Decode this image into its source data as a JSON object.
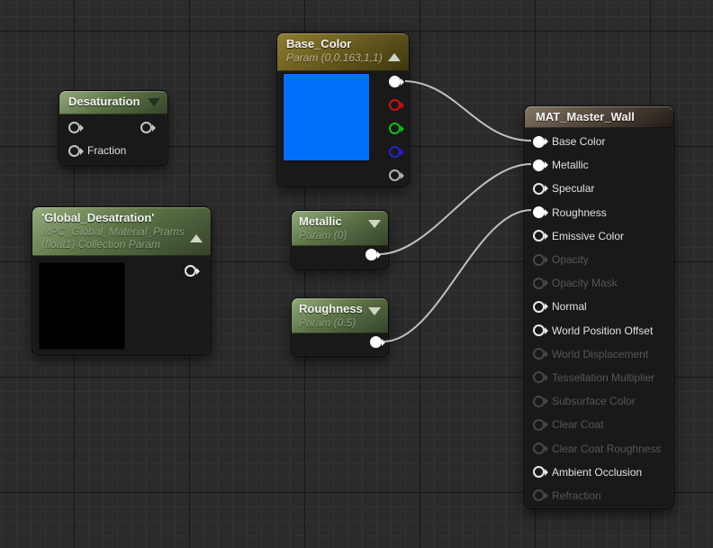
{
  "graph": {
    "background_color": "#2b2b2b",
    "wire_color": "#cdcdcd"
  },
  "nodes": {
    "desaturation": {
      "title": "Desaturation",
      "collapse_arrow": "down",
      "fraction_label": "Fraction"
    },
    "base_color": {
      "title": "Base_Color",
      "subtitle": "Param (0,0.163,1,1)",
      "collapse_arrow": "up",
      "swatch_color": "#0070fa",
      "output_pins": [
        {
          "name": "rgb",
          "color": "#ffffff",
          "filled": true
        },
        {
          "name": "red-channel",
          "color": "#cf1010",
          "filled": false
        },
        {
          "name": "green-channel",
          "color": "#16bd16",
          "filled": false
        },
        {
          "name": "blue-channel",
          "color": "#2222cf",
          "filled": false
        },
        {
          "name": "alpha-channel",
          "color": "#b2b2b2",
          "filled": false
        }
      ]
    },
    "global_desatration": {
      "title": "'Global_Desatration'",
      "subtitle": "MPC_Global_Material_Prams (float1) Collection Param",
      "collapse_arrow": "up",
      "swatch_color": "#000000"
    },
    "metallic": {
      "title": "Metallic",
      "subtitle": "Param (0)",
      "collapse_arrow": "down"
    },
    "roughness": {
      "title": "Roughness",
      "subtitle": "Param (0.5)",
      "collapse_arrow": "down"
    },
    "mat_master_wall": {
      "title": "MAT_Master_Wall",
      "inputs": [
        {
          "label": "Base Color",
          "state": "connected"
        },
        {
          "label": "Metallic",
          "state": "connected"
        },
        {
          "label": "Specular",
          "state": "open"
        },
        {
          "label": "Roughness",
          "state": "connected"
        },
        {
          "label": "Emissive Color",
          "state": "open"
        },
        {
          "label": "Opacity",
          "state": "disabled"
        },
        {
          "label": "Opacity Mask",
          "state": "disabled"
        },
        {
          "label": "Normal",
          "state": "open"
        },
        {
          "label": "World Position Offset",
          "state": "open"
        },
        {
          "label": "World Displacement",
          "state": "disabled"
        },
        {
          "label": "Tessellation Multiplier",
          "state": "disabled"
        },
        {
          "label": "Subsurface Color",
          "state": "disabled"
        },
        {
          "label": "Clear Coat",
          "state": "disabled"
        },
        {
          "label": "Clear Coat Roughness",
          "state": "disabled"
        },
        {
          "label": "Ambient Occlusion",
          "state": "open"
        },
        {
          "label": "Refraction",
          "state": "disabled"
        }
      ]
    }
  }
}
